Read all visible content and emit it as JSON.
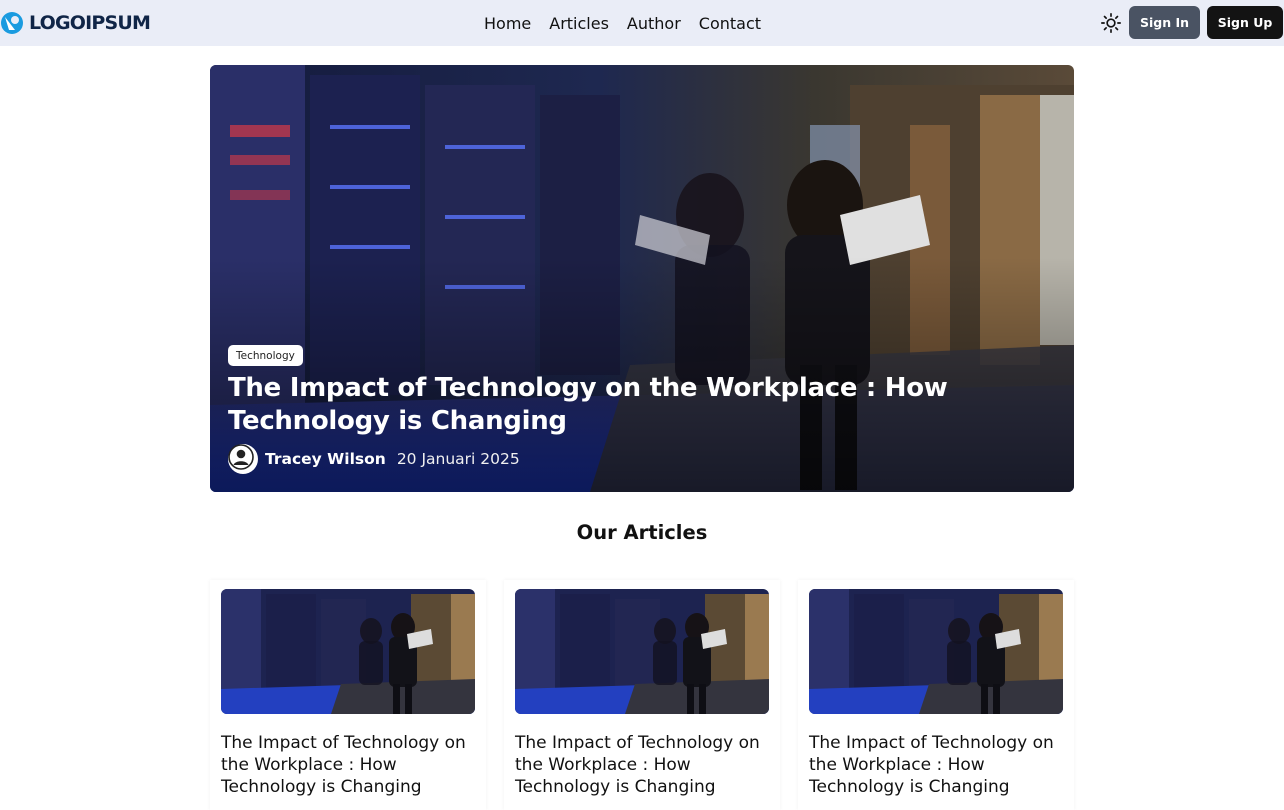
{
  "header": {
    "logo_text": "LOGOIPSUM",
    "nav": [
      "Home",
      "Articles",
      "Author",
      "Contact"
    ],
    "theme_icon": "sun-icon",
    "sign_in": "Sign In",
    "sign_up": "Sign Up"
  },
  "hero": {
    "tag": "Technology",
    "title": "The Impact of Technology on the Workplace : How Technology is Changing",
    "author": "Tracey Wilson",
    "date": "20 Januari 2025"
  },
  "section": {
    "title": "Our Articles"
  },
  "cards": [
    {
      "title": "The Impact of Technology on the Workplace : How Technology is Changing"
    },
    {
      "title": "The Impact of Technology on the Workplace : How Technology is Changing"
    },
    {
      "title": "The Impact of Technology on the Workplace : How Technology is Changing"
    }
  ],
  "colors": {
    "header_bg": "#eaedf7",
    "sign_in_bg": "#4a5363",
    "sign_up_bg": "#131313",
    "logo_accent": "#1a9be0"
  }
}
